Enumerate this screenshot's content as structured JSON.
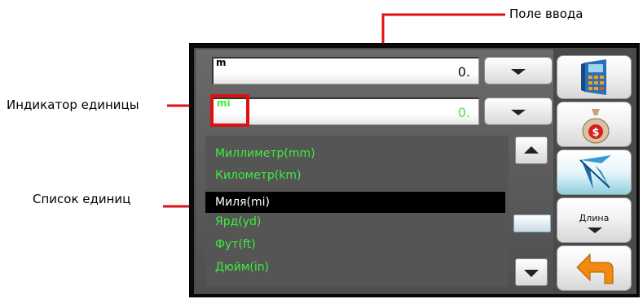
{
  "callouts": {
    "input_field": "Поле ввода",
    "unit_indicator": "Индикатор единицы",
    "unit_list": "Список единиц"
  },
  "converter": {
    "top_field": {
      "unit": "m",
      "value": "0."
    },
    "bottom_field": {
      "unit": "mi",
      "value": "0."
    },
    "units": [
      {
        "label": "Миллиметр(mm)",
        "selected": false
      },
      {
        "label": "Километр(km)",
        "selected": false
      },
      {
        "label": "Миля(mi)",
        "selected": true
      },
      {
        "label": "Ярд(yd)",
        "selected": false
      },
      {
        "label": "Фут(ft)",
        "selected": false
      },
      {
        "label": "Дюйм(in)",
        "selected": false
      }
    ],
    "sidebar": {
      "calculator_icon": "calculator-icon",
      "currency_icon": "money-bag-icon",
      "compass_icon": "compass-icon",
      "category_label": "Длина",
      "back_icon": "back-arrow-icon"
    },
    "colors": {
      "unit_text": "#3cf03c",
      "highlight": "#e01010",
      "selected_bg": "#000000"
    }
  }
}
